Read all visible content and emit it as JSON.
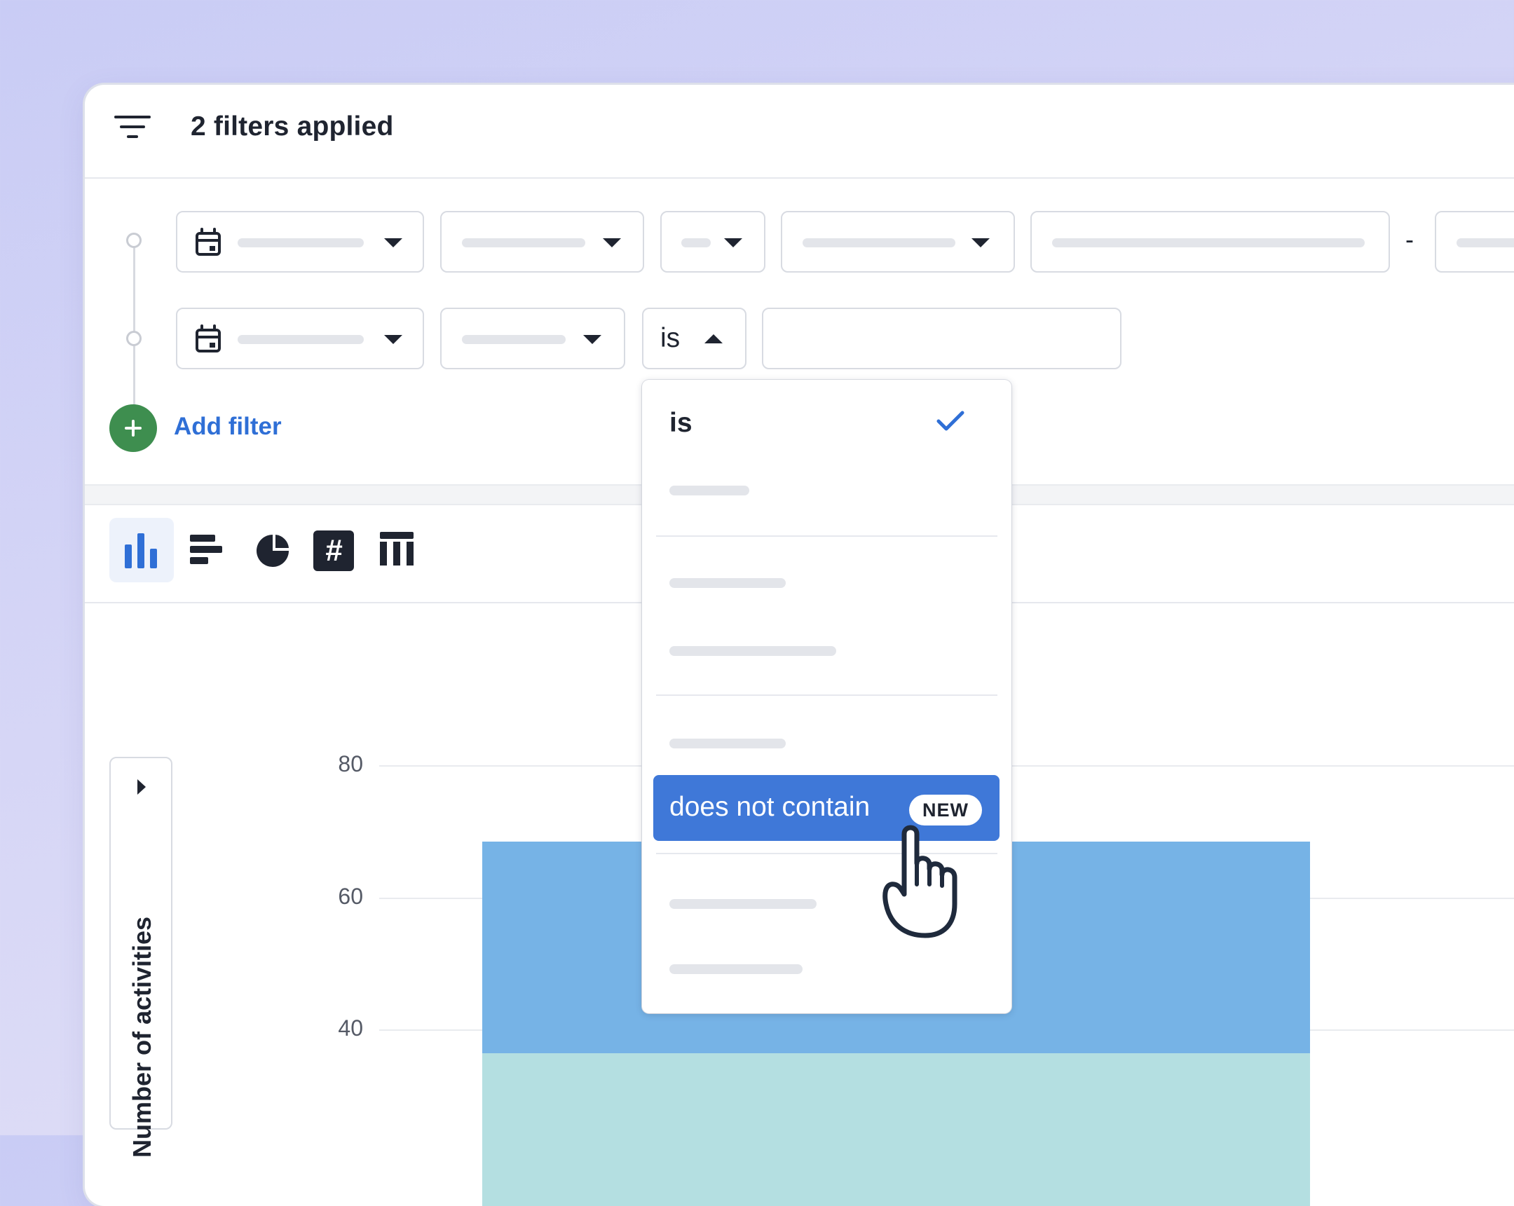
{
  "header": {
    "title": "2 filters applied",
    "icon": "filter-lines-icon"
  },
  "filters": {
    "row2_operator": "is",
    "range_separator": "-",
    "add_filter_label": "Add filter"
  },
  "toolbar": {
    "buttons": [
      {
        "name": "vertical-bar-chart",
        "icon": "bar-chart-icon",
        "active": true
      },
      {
        "name": "horizontal-bar-chart",
        "icon": "horizontal-bars-icon",
        "active": false
      },
      {
        "name": "pie-chart",
        "icon": "pie-chart-icon",
        "active": false
      },
      {
        "name": "number",
        "icon": "hash-icon",
        "active": false
      },
      {
        "name": "table",
        "icon": "table-icon",
        "active": false
      }
    ]
  },
  "dropdown": {
    "selected_option": "is",
    "highlighted_option": "does not contain",
    "badge": "NEW"
  },
  "chart_data": {
    "type": "bar",
    "ylabel": "Number of activities",
    "y_ticks": [
      80,
      60,
      40
    ],
    "stacked": true,
    "colors": [
      "#b4dfe1",
      "#76b3e6"
    ]
  },
  "colors": {
    "accent": "#3f78d8",
    "add_button": "#3e8e4f",
    "link": "#2f6fd6"
  }
}
